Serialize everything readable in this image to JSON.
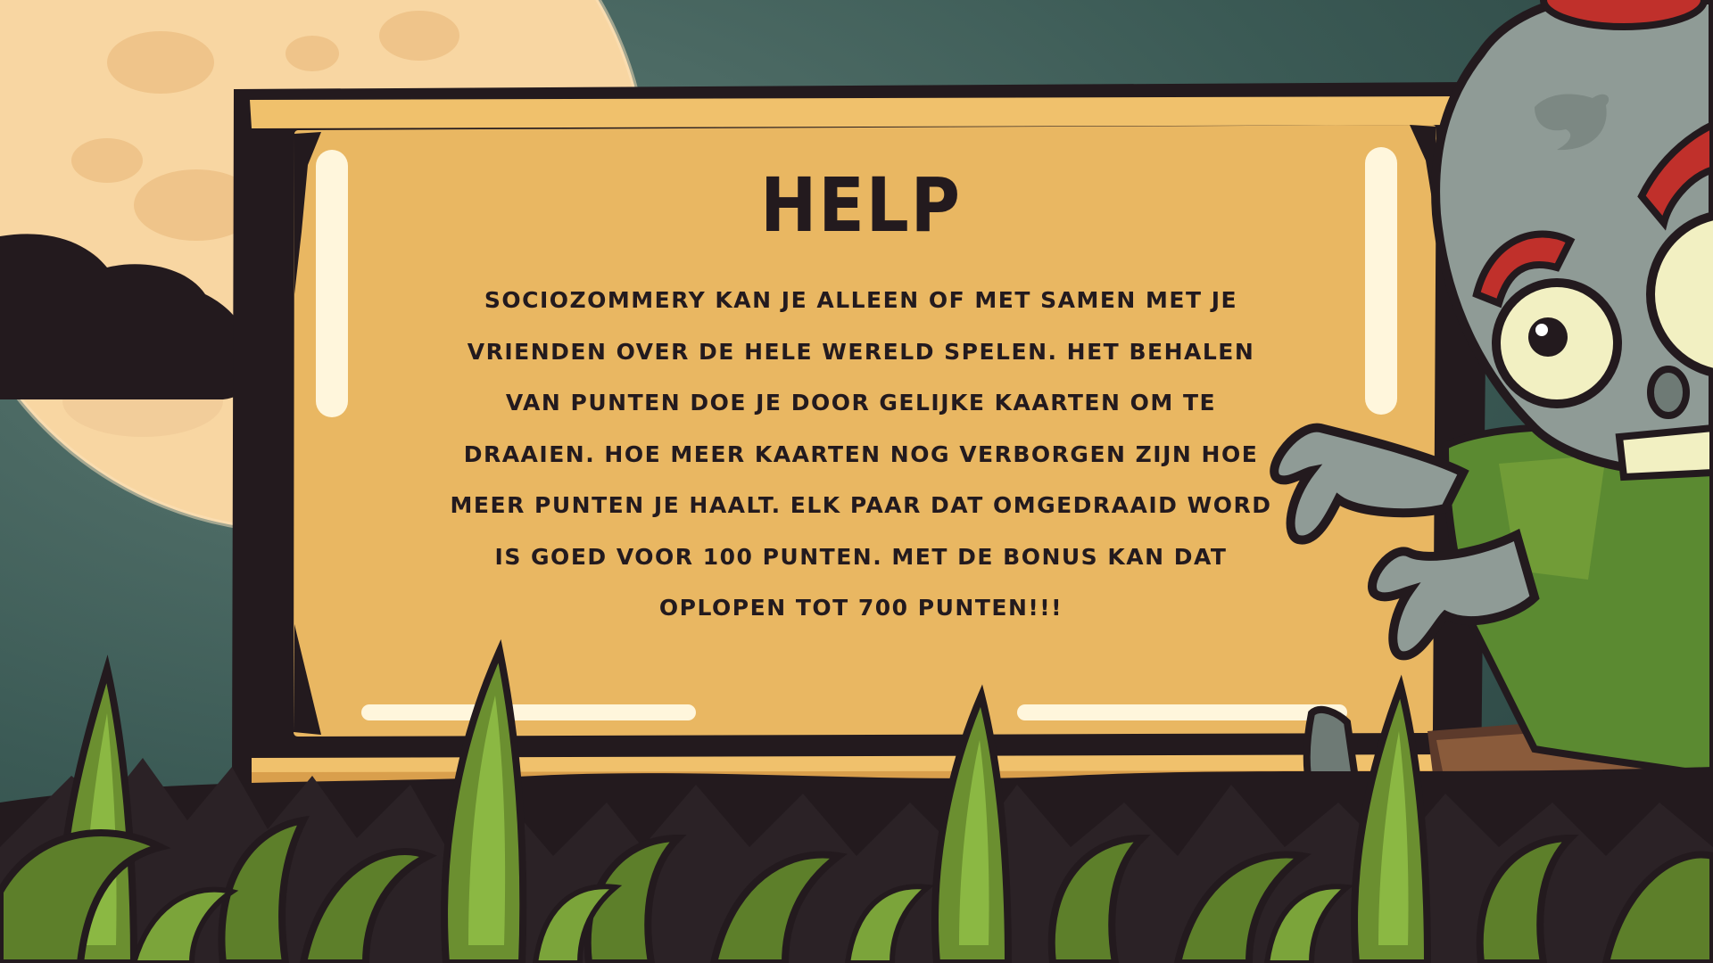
{
  "help": {
    "title": "HELP",
    "body": "Sociozommery kan je alleen of met samen met je vrienden over de hele wereld spelen. Het behalen van punten doe je door gelijke kaarten om te draaien. Hoe meer kaarten nog verborgen zijn hoe meer punten je haalt. Elk paar dat omgedraaid word is goed voor 100 punten. Met de bonus kan dat oplopen tot 700 punten!!!"
  },
  "colors": {
    "sky": "#3b5a55",
    "moon": "#f8d6a2",
    "board": "#e9b762",
    "board_frame": "#231a1e",
    "grass": "#7ba43a",
    "zombie_skin": "#8f9b96",
    "text": "#231a1e"
  },
  "icons": [
    "moon-icon",
    "cloud-icon",
    "zombie-icon",
    "grass-icon",
    "bird-icon"
  ]
}
